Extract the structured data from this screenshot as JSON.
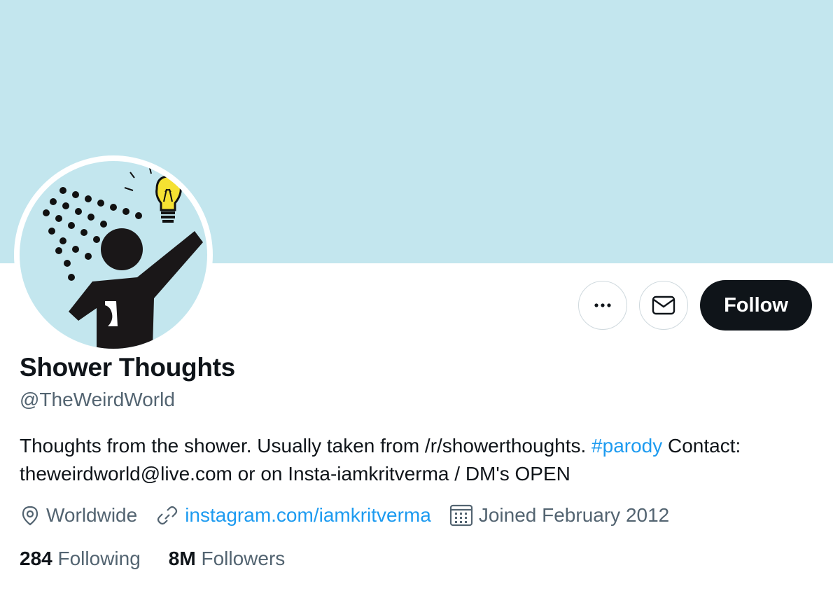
{
  "colors": {
    "banner": "#c3e6ee",
    "accent": "#1d9bf0",
    "text_primary": "#0f1419",
    "text_secondary": "#536471",
    "follow_bg": "#0f1419",
    "avatar_bg": "#c3e6ee",
    "bulb": "#f5e132"
  },
  "profile": {
    "name": "Shower Thoughts",
    "handle": "@TheWeirdWorld",
    "bio_text_1": "Thoughts from the shower. Usually taken from /r/showerthoughts.",
    "bio_hashtag": "#parody",
    "bio_text_2": "Contact: theweirdworld@live.com or on Insta-iamkritverma / DM's OPEN"
  },
  "actions": {
    "more_icon": "more-horizontal-icon",
    "message_icon": "envelope-icon",
    "follow_label": "Follow"
  },
  "meta": {
    "location": "Worldwide",
    "location_icon": "location-pin-icon",
    "website": "instagram.com/iamkritverma",
    "website_icon": "link-icon",
    "joined": "Joined February 2012",
    "joined_icon": "calendar-icon"
  },
  "stats": {
    "following_count": "284",
    "following_label": "Following",
    "followers_count": "8M",
    "followers_label": "Followers"
  }
}
